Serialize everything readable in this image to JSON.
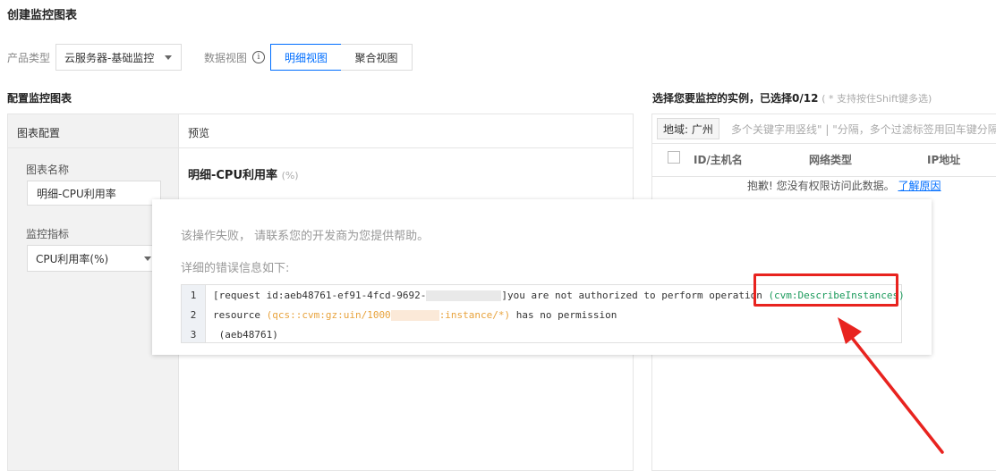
{
  "page_title": "创建监控图表",
  "filters": {
    "product_type_label": "产品类型",
    "product_type_value": "云服务器-基础监控",
    "data_view_label": "数据视图",
    "views": [
      "明细视图",
      "聚合视图"
    ],
    "active_view": "明细视图"
  },
  "config": {
    "section_title": "配置监控图表",
    "chart_config_header": "图表配置",
    "chart_name_label": "图表名称",
    "chart_name_value": "明细-CPU利用率",
    "metric_label": "监控指标",
    "metric_value": "CPU利用率(%)",
    "preview_header": "预览",
    "preview_title": "明细-CPU利用率",
    "preview_unit": "(%)"
  },
  "instances": {
    "section_title": "选择您要监控的实例，已选择0/12",
    "hint": "( * 支持按住Shift键多选)",
    "region_tag": "地域: 广州",
    "search_placeholder": "多个关键字用竖线\" | \"分隔，多个过滤标签用回车键分隔",
    "columns": [
      "ID/主机名",
      "网络类型",
      "IP地址"
    ],
    "no_permission": "抱歉! 您没有权限访问此数据。",
    "learn_reason": "了解原因"
  },
  "error_dialog": {
    "message": "该操作失败， 请联系您的开发商为您提供帮助。",
    "detail_label": "详细的错误信息如下:",
    "lines": [
      {
        "num": "1",
        "prefix": "[request id:aeb48761-ef91-4fcd-9692-",
        "suffix": "]you are not authorized to perform operation ",
        "highlight": "(cvm:DescribeInstances)"
      },
      {
        "num": "2",
        "prefix": "resource ",
        "resource_start": "(qcs::cvm:gz:uin/1000",
        "resource_end": ":instance/*)",
        "suffix": " has no permission"
      },
      {
        "num": "3",
        "text": " (aeb48761)"
      }
    ]
  },
  "colors": {
    "accent": "#006eff",
    "annotation_red": "#e8231f",
    "highlight_green": "#1a9a5b",
    "resource_orange": "#e8a33d"
  }
}
